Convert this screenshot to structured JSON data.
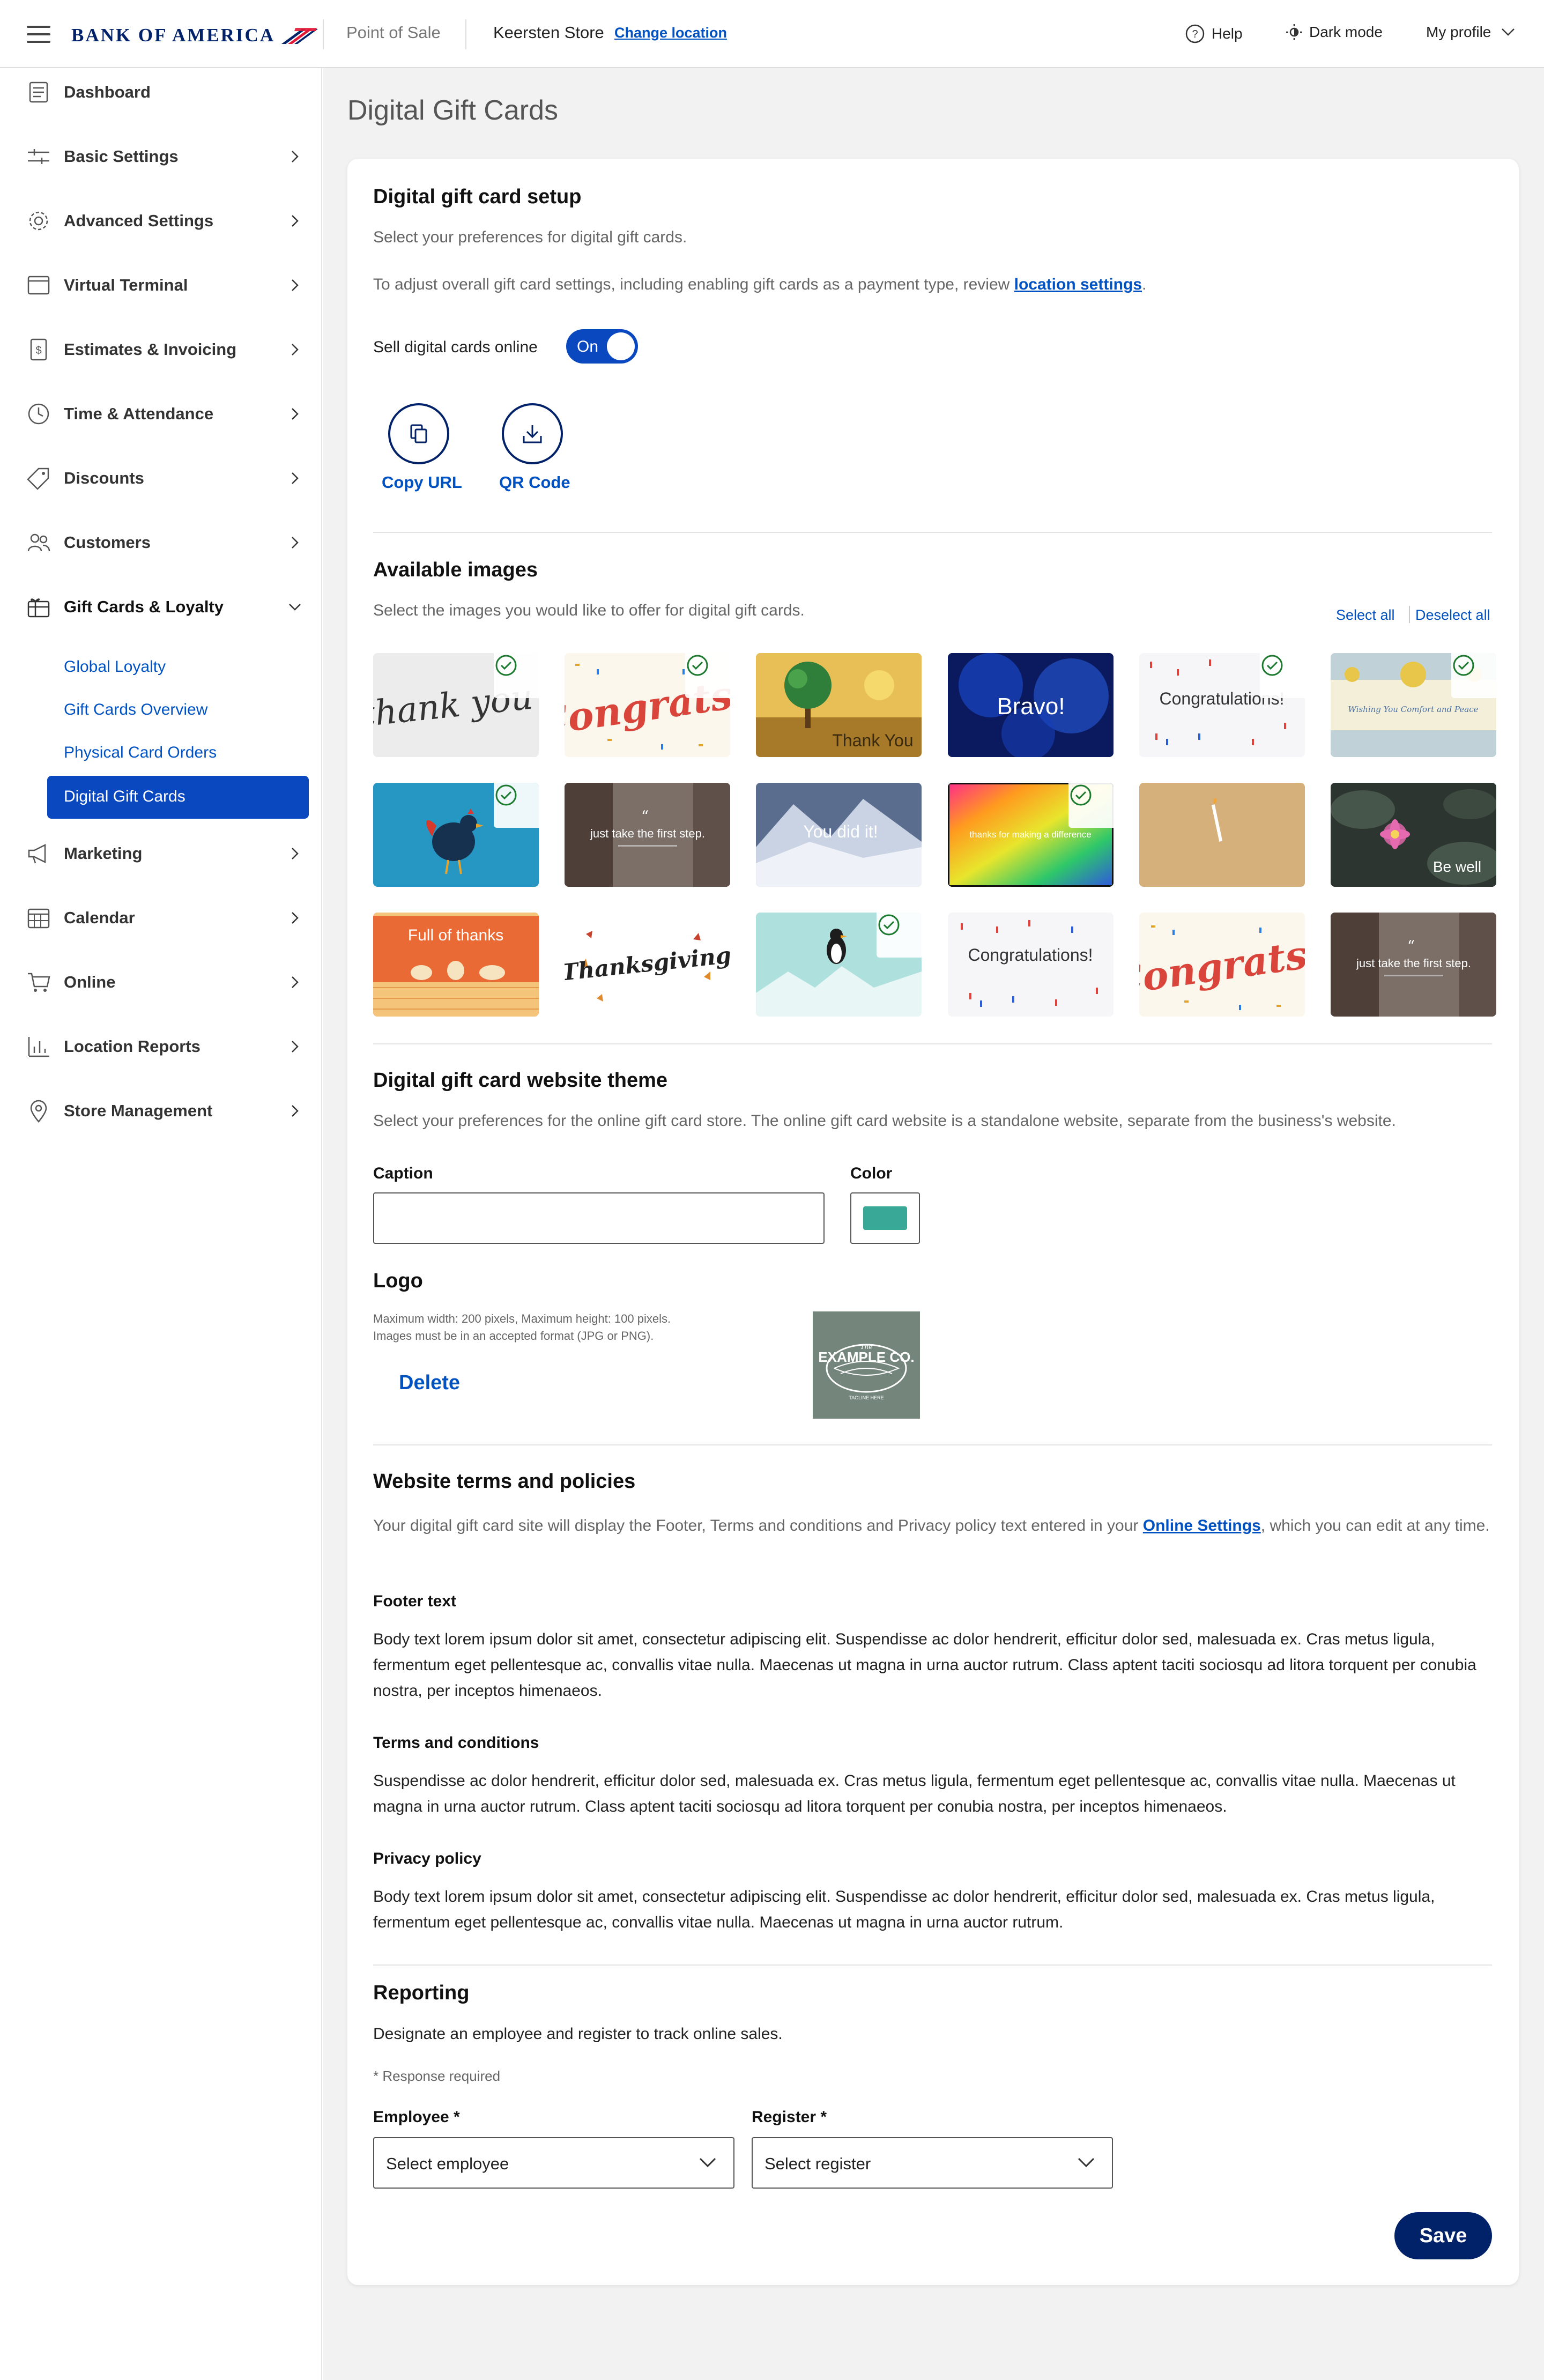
{
  "header": {
    "brand": "BANK OF AMERICA",
    "app_name": "Point of Sale",
    "store": "Keersten Store",
    "change_location": "Change location",
    "help": "Help",
    "dark_mode": "Dark mode",
    "profile": "My profile"
  },
  "sidebar": {
    "items": [
      {
        "label": "Dashboard",
        "icon": "dashboard-icon"
      },
      {
        "label": "Basic Settings",
        "icon": "sliders-icon"
      },
      {
        "label": "Advanced Settings",
        "icon": "gear-icon"
      },
      {
        "label": "Virtual Terminal",
        "icon": "terminal-icon"
      },
      {
        "label": "Estimates & Invoicing",
        "icon": "invoice-icon"
      },
      {
        "label": "Time & Attendance",
        "icon": "clock-icon"
      },
      {
        "label": "Discounts",
        "icon": "tag-icon"
      },
      {
        "label": "Customers",
        "icon": "people-icon"
      },
      {
        "label": "Gift Cards & Loyalty",
        "icon": "gift-icon"
      },
      {
        "label": "Marketing",
        "icon": "megaphone-icon"
      },
      {
        "label": "Calendar",
        "icon": "calendar-icon"
      },
      {
        "label": "Online",
        "icon": "cart-icon"
      },
      {
        "label": "Location Reports",
        "icon": "chart-icon"
      },
      {
        "label": "Store Management",
        "icon": "pin-icon"
      }
    ],
    "sub_items": [
      "Global Loyalty",
      "Gift Cards Overview",
      "Physical Card Orders",
      "Digital Gift Cards"
    ]
  },
  "page": {
    "title": "Digital Gift Cards"
  },
  "setup": {
    "heading": "Digital gift card setup",
    "desc": "Select your preferences for digital gift cards.",
    "adjust_prefix": "To adjust overall gift card settings, including enabling gift cards as a payment type, review ",
    "adjust_link": "location settings",
    "adjust_suffix": ".",
    "sell_label": "Sell digital cards online",
    "toggle_state": "On",
    "copy_url": "Copy URL",
    "qr_code": "QR Code"
  },
  "images": {
    "heading": "Available images",
    "desc": "Select the images you would like to offer for digital gift cards.",
    "select_all": "Select all",
    "deselect_all": "Deselect all",
    "tiles": [
      {
        "caption": "thank you",
        "selected": true
      },
      {
        "caption": "Congrats!",
        "selected": true
      },
      {
        "caption": "Thank You",
        "selected": false
      },
      {
        "caption": "Bravo!",
        "selected": false
      },
      {
        "caption": "Congratulations!",
        "selected": true
      },
      {
        "caption": "Wishing You Comfort and Peace",
        "selected": true
      },
      {
        "caption": "",
        "selected": true
      },
      {
        "caption": "just take the first step.",
        "selected": false
      },
      {
        "caption": "You did it!",
        "selected": false
      },
      {
        "caption": "thanks for making a difference",
        "selected": true
      },
      {
        "caption": "",
        "selected": false
      },
      {
        "caption": "Be well",
        "selected": false
      },
      {
        "caption": "Full of thanks",
        "selected": false
      },
      {
        "caption": "Thanksgiving",
        "selected": false
      },
      {
        "caption": "",
        "selected": true
      },
      {
        "caption": "Congratulations!",
        "selected": false
      },
      {
        "caption": "Congrats!",
        "selected": false
      },
      {
        "caption": "just take the first step.",
        "selected": false
      }
    ]
  },
  "theme": {
    "heading": "Digital gift card website theme",
    "desc": "Select your preferences for the online gift card store. The online gift card website is a standalone website, separate from the business's website.",
    "caption_label": "Caption",
    "caption_value": "",
    "color_label": "Color",
    "color_value": "#3aa896",
    "logo_label": "Logo",
    "logo_note_1": "Maximum width: 200 pixels, Maximum height: 100 pixels.",
    "logo_note_2": "Images must be in an accepted format (JPG or PNG).",
    "delete": "Delete",
    "logo_text_small": "The",
    "logo_text_big": "EXAMPLE CO.",
    "logo_text_tag": "TAGLINE HERE"
  },
  "terms": {
    "heading": "Website terms and policies",
    "desc_prefix": "Your digital gift card site will display the Footer, Terms and conditions and Privacy policy text entered in your ",
    "desc_link": "Online Settings",
    "desc_suffix": ", which you can edit at any time.",
    "footer_label": "Footer text",
    "footer_text": "Body text lorem ipsum dolor sit amet, consectetur adipiscing elit. Suspendisse ac dolor hendrerit, efficitur dolor sed, malesuada ex. Cras metus ligula, fermentum eget pellentesque ac, convallis vitae nulla. Maecenas ut magna in urna auctor rutrum. Class aptent taciti sociosqu ad litora torquent per conubia nostra, per inceptos himenaeos.",
    "terms_label": "Terms and conditions",
    "terms_text": "Suspendisse ac dolor hendrerit, efficitur dolor sed, malesuada ex. Cras metus ligula, fermentum eget pellentesque ac, convallis vitae nulla. Maecenas ut magna in urna auctor rutrum. Class aptent taciti sociosqu ad litora torquent per conubia nostra, per inceptos himenaeos.",
    "privacy_label": "Privacy policy",
    "privacy_text": "Body text lorem ipsum dolor sit amet, consectetur adipiscing elit. Suspendisse ac dolor hendrerit, efficitur dolor sed, malesuada ex. Cras metus ligula, fermentum eget pellentesque ac, convallis vitae nulla. Maecenas ut magna in urna auctor rutrum."
  },
  "reporting": {
    "heading": "Reporting",
    "desc": "Designate an employee and register to track online sales.",
    "required_note": "* Response required",
    "employee_label": "Employee *",
    "employee_value": "Select employee",
    "register_label": "Register *",
    "register_value": "Select register"
  },
  "save": "Save",
  "colors": {
    "brand_navy": "#012169",
    "link_blue": "#0052c2",
    "accent_red": "#e31837"
  }
}
